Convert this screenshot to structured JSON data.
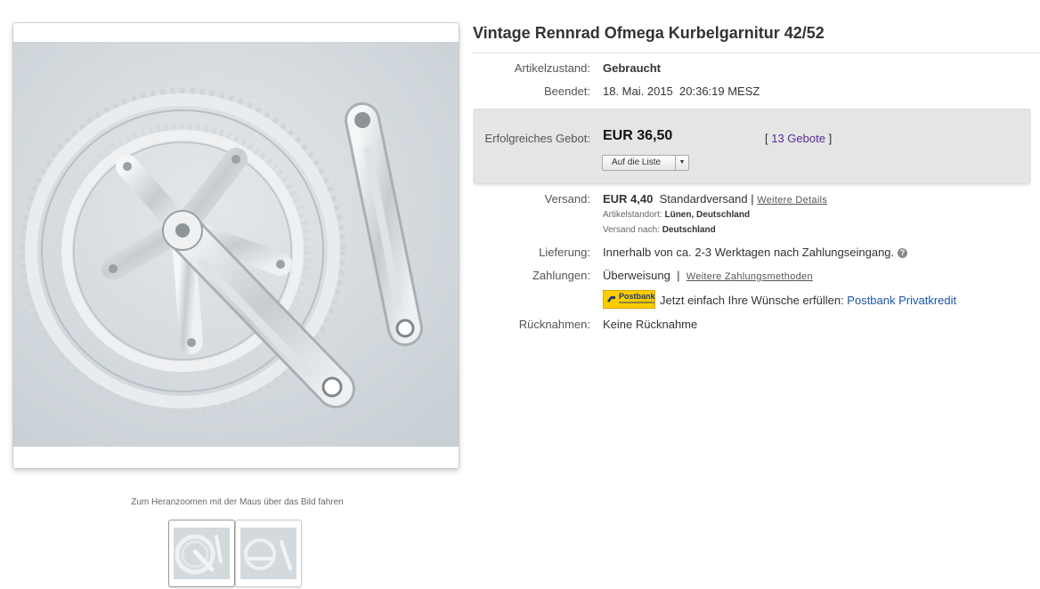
{
  "listing": {
    "title": "Vintage Rennrad Ofmega Kurbelgarnitur 42/52"
  },
  "gallery": {
    "zoom_hint": "Zum Heranzoomen mit der Maus über das Bild fahren",
    "main_image_icon": "crankset-photo",
    "thumbnails": [
      "crankset-thumb-1",
      "crankset-thumb-2"
    ]
  },
  "details": {
    "condition_label": "Artikelzustand:",
    "condition_value": "Gebraucht",
    "ended_label": "Beendet:",
    "ended_date": "18. Mai. 2015",
    "ended_time": "20:36:19 MESZ"
  },
  "bid": {
    "label": "Erfolgreiches Gebot:",
    "price": "EUR 36,50",
    "bids_open": "[ ",
    "bids_link": "13 Gebote",
    "bids_close": " ]",
    "watch_button": "Auf die Liste"
  },
  "shipping": {
    "label": "Versand:",
    "cost": "EUR 4,40",
    "method": "Standardversand |",
    "details_link": "Weitere Details",
    "location_label": "Artikelstandort:",
    "location_value": "Lünen, Deutschland",
    "ships_to_label": "Versand nach:",
    "ships_to_value": "Deutschland"
  },
  "delivery": {
    "label": "Lieferung:",
    "value": "Innerhalb von ca. 2-3 Werktagen nach Zahlungseingang."
  },
  "payment": {
    "label": "Zahlungen:",
    "method": "Überweisung",
    "separator": "|",
    "more_link": "Weitere Zahlungsmethoden",
    "postbank_logo_text": "Postbank",
    "promo_text": "Jetzt einfach Ihre Wünsche erfüllen:",
    "promo_link": "Postbank Privatkredit"
  },
  "returns": {
    "label": "Rücknahmen:",
    "value": "Keine Rücknahme"
  },
  "colors": {
    "bid_link": "#5a2b9a",
    "promo_link": "#1a56a7",
    "postbank_yellow": "#ffcc00"
  }
}
